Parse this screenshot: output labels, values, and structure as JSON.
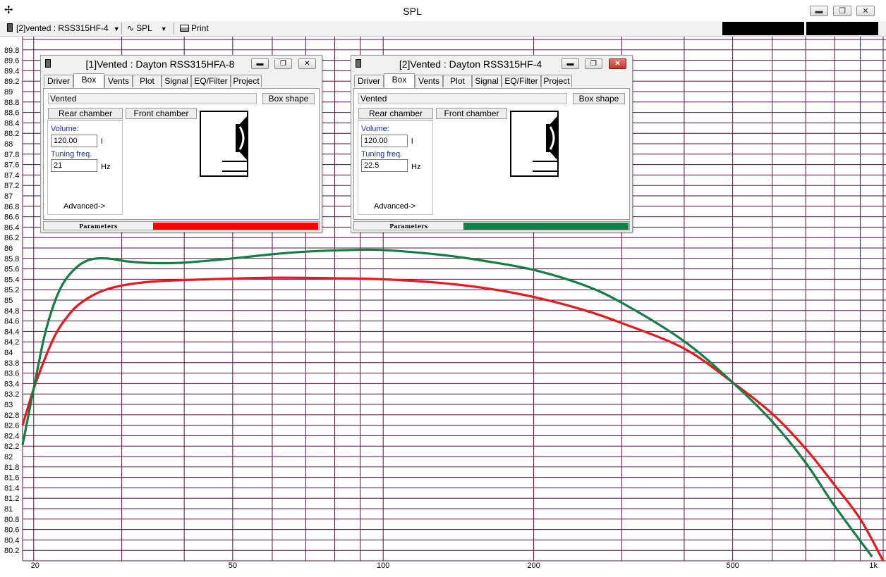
{
  "window": {
    "title": "SPL",
    "app_icon": "crosshair-icon",
    "minimize": "minimize-icon",
    "restore": "restore-icon",
    "close": "close-icon"
  },
  "toolbar": {
    "project_selector": "[2]vented : RSS315HF-4",
    "view_selector": "SPL",
    "print_label": "Print"
  },
  "chart_data": {
    "type": "line",
    "xscale": "log",
    "xlim": [
      19,
      1000
    ],
    "ylim": [
      80,
      90
    ],
    "x_ticks": [
      {
        "v": 20,
        "t": "20"
      },
      {
        "v": 50,
        "t": "50"
      },
      {
        "v": 100,
        "t": "100"
      },
      {
        "v": 200,
        "t": "200"
      },
      {
        "v": 500,
        "t": "500"
      },
      {
        "v": 1000,
        "t": "1k"
      }
    ],
    "y_step": 0.2,
    "grid": true,
    "series": [
      {
        "color": "#e8181c",
        "points": [
          [
            19,
            82.6
          ],
          [
            20,
            83.3
          ],
          [
            21,
            83.85
          ],
          [
            22,
            84.3
          ],
          [
            23,
            84.6
          ],
          [
            24.5,
            84.9
          ],
          [
            27,
            85.15
          ],
          [
            30,
            85.28
          ],
          [
            35,
            85.36
          ],
          [
            45,
            85.4
          ],
          [
            60,
            85.43
          ],
          [
            80,
            85.42
          ],
          [
            100,
            85.4
          ],
          [
            130,
            85.33
          ],
          [
            160,
            85.23
          ],
          [
            200,
            85.06
          ],
          [
            250,
            84.82
          ],
          [
            300,
            84.56
          ],
          [
            400,
            84.07
          ],
          [
            500,
            83.42
          ],
          [
            600,
            82.82
          ],
          [
            700,
            82.15
          ],
          [
            800,
            81.45
          ],
          [
            900,
            80.8
          ],
          [
            1000,
            80.0
          ]
        ]
      },
      {
        "color": "#137f45",
        "points": [
          [
            19,
            82.22
          ],
          [
            20,
            83.3
          ],
          [
            21,
            84.3
          ],
          [
            22,
            84.95
          ],
          [
            23,
            85.35
          ],
          [
            24.5,
            85.65
          ],
          [
            26,
            85.78
          ],
          [
            28,
            85.8
          ],
          [
            31,
            85.74
          ],
          [
            35,
            85.71
          ],
          [
            40,
            85.72
          ],
          [
            50,
            85.8
          ],
          [
            60,
            85.88
          ],
          [
            70,
            85.93
          ],
          [
            85,
            85.96
          ],
          [
            100,
            85.96
          ],
          [
            130,
            85.87
          ],
          [
            160,
            85.75
          ],
          [
            200,
            85.58
          ],
          [
            250,
            85.3
          ],
          [
            300,
            84.95
          ],
          [
            400,
            84.21
          ],
          [
            500,
            83.42
          ],
          [
            600,
            82.67
          ],
          [
            700,
            81.88
          ],
          [
            800,
            81.05
          ],
          [
            950,
            80.08
          ]
        ]
      }
    ]
  },
  "panels": [
    {
      "title": "[1]Vented : Dayton RSS315HFA-8",
      "tabs": [
        "Driver",
        "Box",
        "Vents",
        "Plot",
        "Signal",
        "EQ/Filter",
        "Project"
      ],
      "active_tab": "Box",
      "box_type": "Vented",
      "box_shape_button": "Box shape",
      "rear_chamber_button": "Rear chamber",
      "front_chamber_button": "Front chamber",
      "volume_label": "Volume:",
      "volume_value": "120.00",
      "volume_unit": "l",
      "tuning_label": "Tuning freq.",
      "tuning_value": "21",
      "tuning_unit": "Hz",
      "advanced": "Advanced->",
      "status_label": "Parameters",
      "status_color": "#ff0000"
    },
    {
      "title": "[2]Vented : Dayton RSS315HF-4",
      "tabs": [
        "Driver",
        "Box",
        "Vents",
        "Plot",
        "Signal",
        "EQ/Filter",
        "Project"
      ],
      "active_tab": "Box",
      "box_type": "Vented",
      "box_shape_button": "Box shape",
      "rear_chamber_button": "Rear chamber",
      "front_chamber_button": "Front chamber",
      "volume_label": "Volume:",
      "volume_value": "120.00",
      "volume_unit": "l",
      "tuning_label": "Tuning freq.",
      "tuning_value": "22.5",
      "tuning_unit": "Hz",
      "advanced": "Advanced->",
      "status_label": "Parameters",
      "status_color": "#148047"
    }
  ]
}
